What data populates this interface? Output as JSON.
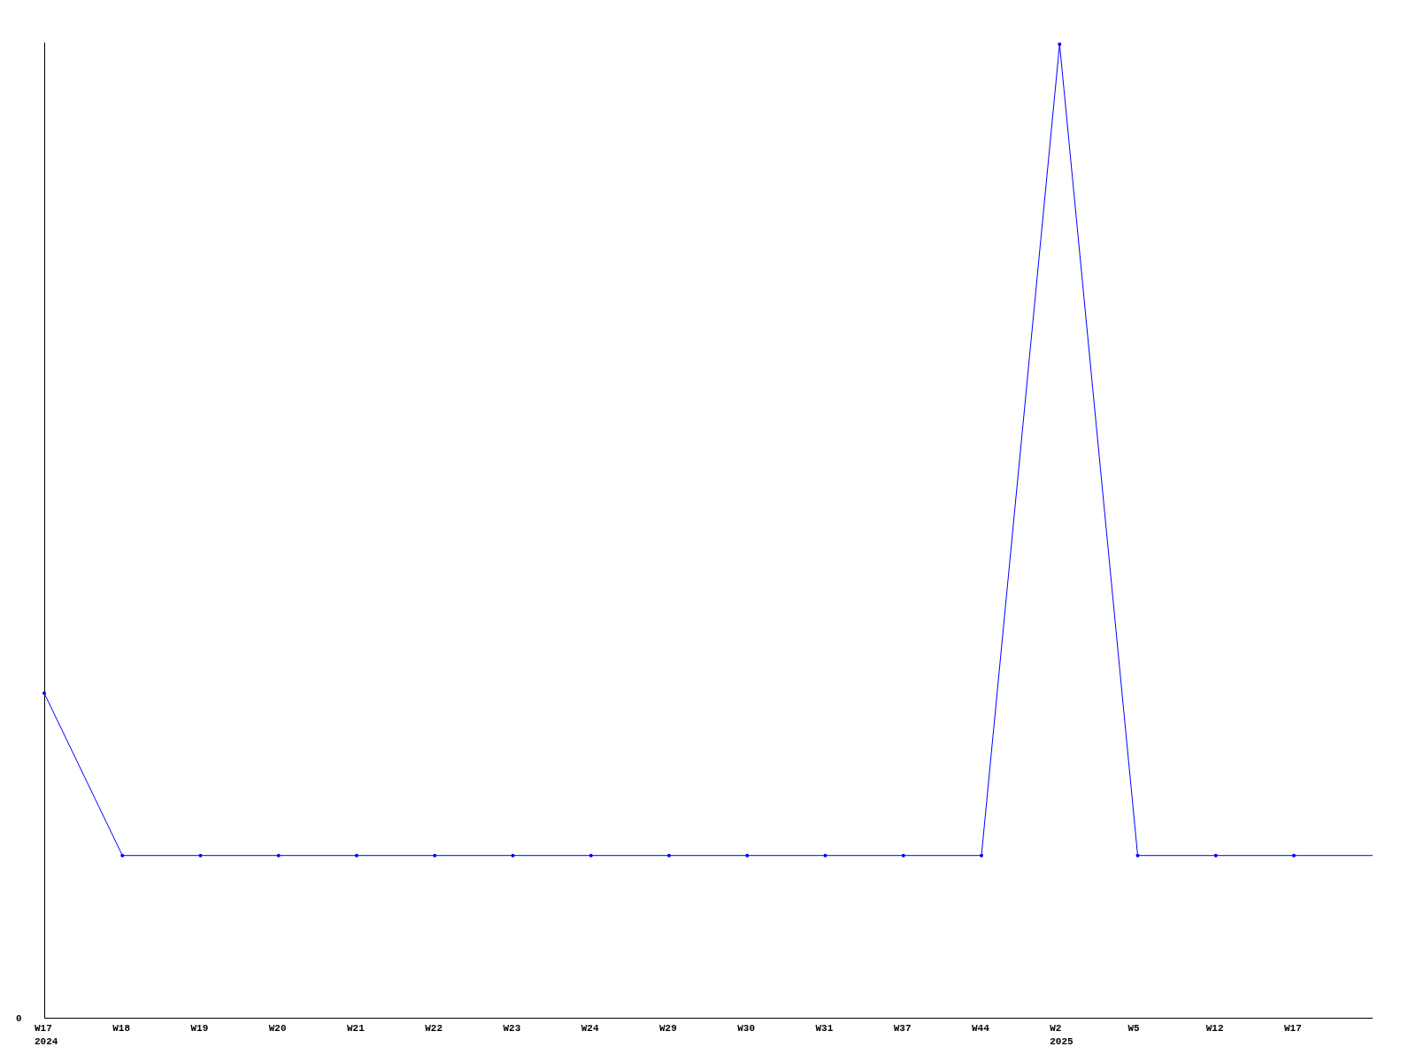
{
  "chart": {
    "y_tick": "0",
    "x_labels": [
      {
        "week": "W17",
        "year": "2024"
      },
      {
        "week": "W18"
      },
      {
        "week": "W19"
      },
      {
        "week": "W20"
      },
      {
        "week": "W21"
      },
      {
        "week": "W22"
      },
      {
        "week": "W23"
      },
      {
        "week": "W24"
      },
      {
        "week": "W29"
      },
      {
        "week": "W30"
      },
      {
        "week": "W31"
      },
      {
        "week": "W37"
      },
      {
        "week": "W44"
      },
      {
        "week": "W2",
        "year": "2025"
      },
      {
        "week": "W5"
      },
      {
        "week": "W12"
      },
      {
        "week": "W17"
      }
    ]
  }
}
